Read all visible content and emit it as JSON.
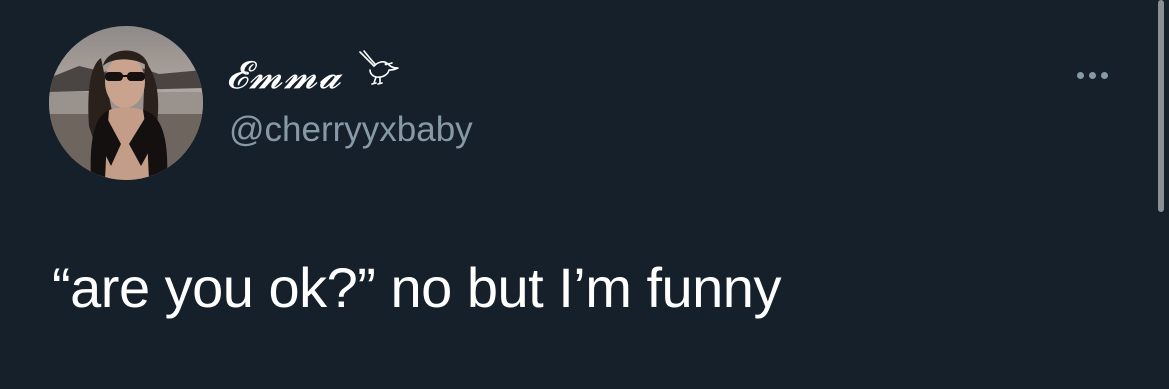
{
  "tweet": {
    "display_name": "𝓔𝓶𝓶𝓪",
    "display_name_emoji": "bird-icon",
    "handle": "@cherryyxbaby",
    "text": "“are you ok?” no but I’m funny",
    "more_icon": "more-options-icon"
  },
  "colors": {
    "background": "#15202b",
    "primary_text": "#ffffff",
    "secondary_text": "#8899a6",
    "scrollbar": "#8a8f94"
  }
}
